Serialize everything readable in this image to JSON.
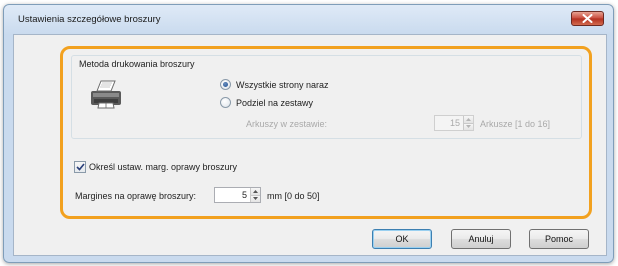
{
  "dialog": {
    "title": "Ustawienia szczegółowe broszury",
    "close_icon": "close-x-icon"
  },
  "colors": {
    "highlight": "#f2a11f",
    "titlebar": "#c9daee",
    "close_button": "#c8493a"
  },
  "print_method": {
    "group_title": "Metoda drukowania broszury",
    "icon": "booklet-printer-icon",
    "options": [
      {
        "label": "Wszystkie strony naraz",
        "selected": true
      },
      {
        "label": "Podziel na zestawy",
        "selected": false
      }
    ],
    "sheets_per_set": {
      "label": "Arkuszy w zestawie:",
      "value": "15",
      "range": "Arkusze [1 do 16]",
      "enabled": false
    }
  },
  "binding_margin": {
    "checkbox_label": "Określ ustaw. marg. oprawy broszury",
    "checked": true,
    "field_label": "Margines na oprawę broszury:",
    "value": "5",
    "range": "mm [0 do 50]"
  },
  "buttons": {
    "ok": "OK",
    "cancel": "Anuluj",
    "help": "Pomoc"
  }
}
